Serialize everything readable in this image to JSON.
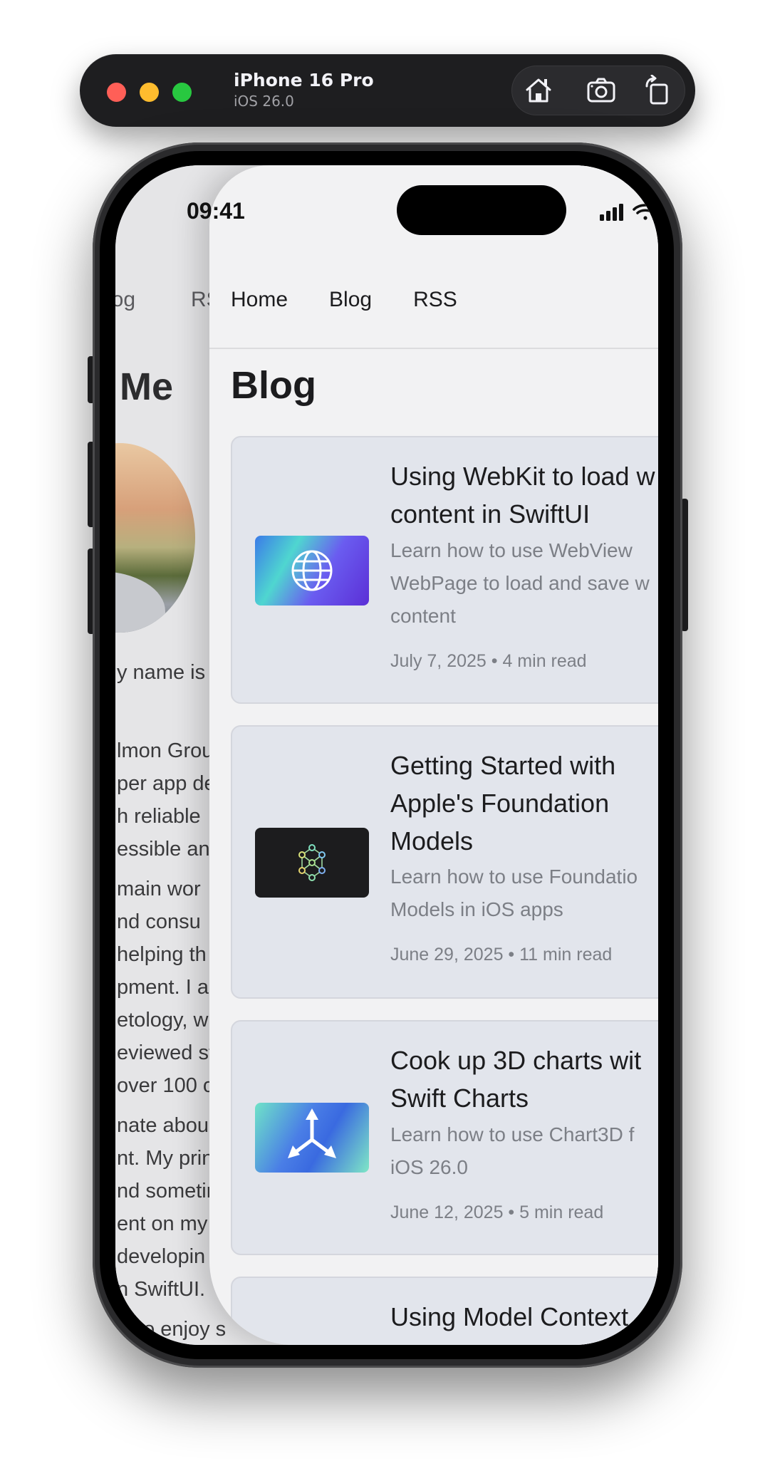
{
  "simulator": {
    "device_name": "iPhone 16 Pro",
    "os_version": "iOS 26.0",
    "buttons": [
      "home-icon",
      "screenshot-icon",
      "rotate-icon"
    ]
  },
  "status_bar": {
    "time": "09:41"
  },
  "background_page": {
    "nav_partial": [
      "log",
      "RS"
    ],
    "title_partial": "Me",
    "lines": [
      "y name is ",
      "lmon Grou",
      "per app de",
      "h reliable",
      "essible an",
      "main wor",
      "nd consu",
      "helping th",
      "pment. I al",
      "etology, wh",
      "eviewed st",
      "over 100 c",
      "nate abou",
      "nt. My prin",
      "nd sometir",
      "ent on my",
      "developin",
      "n SwiftUI.",
      "also enjoy s"
    ]
  },
  "nav": {
    "items": [
      "Home",
      "Blog",
      "RSS"
    ]
  },
  "page_title": "Blog",
  "posts": [
    {
      "title_lines": [
        "Using WebKit to load w",
        "content in SwiftUI"
      ],
      "desc_lines": [
        "Learn how to use WebView",
        "WebPage to load and save w",
        "content"
      ],
      "meta": "July 7, 2025 • 4 min read",
      "thumb_icon": "globe-icon"
    },
    {
      "title_lines": [
        "Getting Started with",
        "Apple's Foundation",
        "Models"
      ],
      "desc_lines": [
        "Learn how to use Foundatio",
        "Models in iOS apps"
      ],
      "meta": "June 29, 2025 • 11 min read",
      "thumb_icon": "neural-network-icon"
    },
    {
      "title_lines": [
        "Cook up 3D charts wit",
        "Swift Charts"
      ],
      "desc_lines": [
        "Learn how to use Chart3D f",
        "iOS 26.0"
      ],
      "meta": "June 12, 2025 • 5 min read",
      "thumb_icon": "3d-axes-icon"
    },
    {
      "title_lines": [
        "Using Model Context"
      ],
      "desc_lines": [],
      "meta": "",
      "thumb_icon": ""
    }
  ],
  "colors": {
    "card_bg": "#e2e5ec",
    "page_bg": "#f2f2f3",
    "battery": "#34c759"
  }
}
